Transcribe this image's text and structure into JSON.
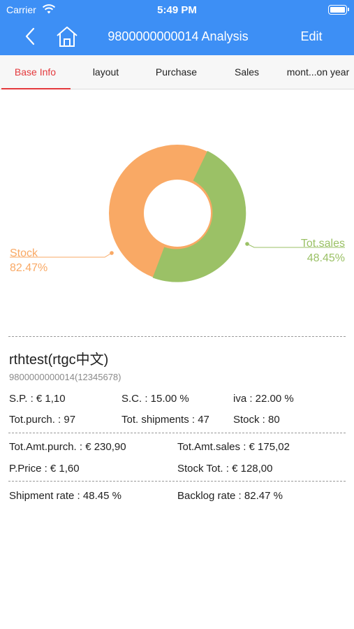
{
  "status_bar": {
    "carrier": "Carrier",
    "time": "5:49 PM"
  },
  "nav": {
    "title": "9800000000014 Analysis",
    "edit_label": "Edit"
  },
  "tabs": [
    {
      "label": "Base Info",
      "active": true
    },
    {
      "label": "layout"
    },
    {
      "label": "Purchase"
    },
    {
      "label": "Sales"
    },
    {
      "label": "mont...on year"
    }
  ],
  "chart_data": {
    "type": "pie",
    "style": "donut",
    "slices": [
      {
        "label": "Stock",
        "value_label": "82.47%",
        "color": "#f9a965"
      },
      {
        "label": "Tot.sales",
        "value_label": "48.45%",
        "color": "#9bc166"
      }
    ]
  },
  "product": {
    "name": "rthtest(rtgc中文)",
    "code": "9800000000014(12345678)"
  },
  "stats": {
    "sp": "S.P. : € 1,10",
    "sc": "S.C. : 15.00 %",
    "iva": "iva : 22.00 %",
    "tot_purch": "Tot.purch. : 97",
    "tot_shipments": "Tot. shipments : 47",
    "stock": "Stock : 80",
    "tot_amt_purch": "Tot.Amt.purch. : € 230,90",
    "tot_amt_sales": "Tot.Amt.sales : € 175,02",
    "p_price": "P.Price : € 1,60",
    "stock_tot": "Stock Tot. : € 128,00",
    "shipment_rate": "Shipment rate : 48.45 %",
    "backlog_rate": "Backlog rate : 82.47 %"
  },
  "colors": {
    "nav_bg": "#3d8ff5",
    "tab_active": "#e4393c",
    "stock": "#f9a965",
    "sales": "#9bc166"
  }
}
